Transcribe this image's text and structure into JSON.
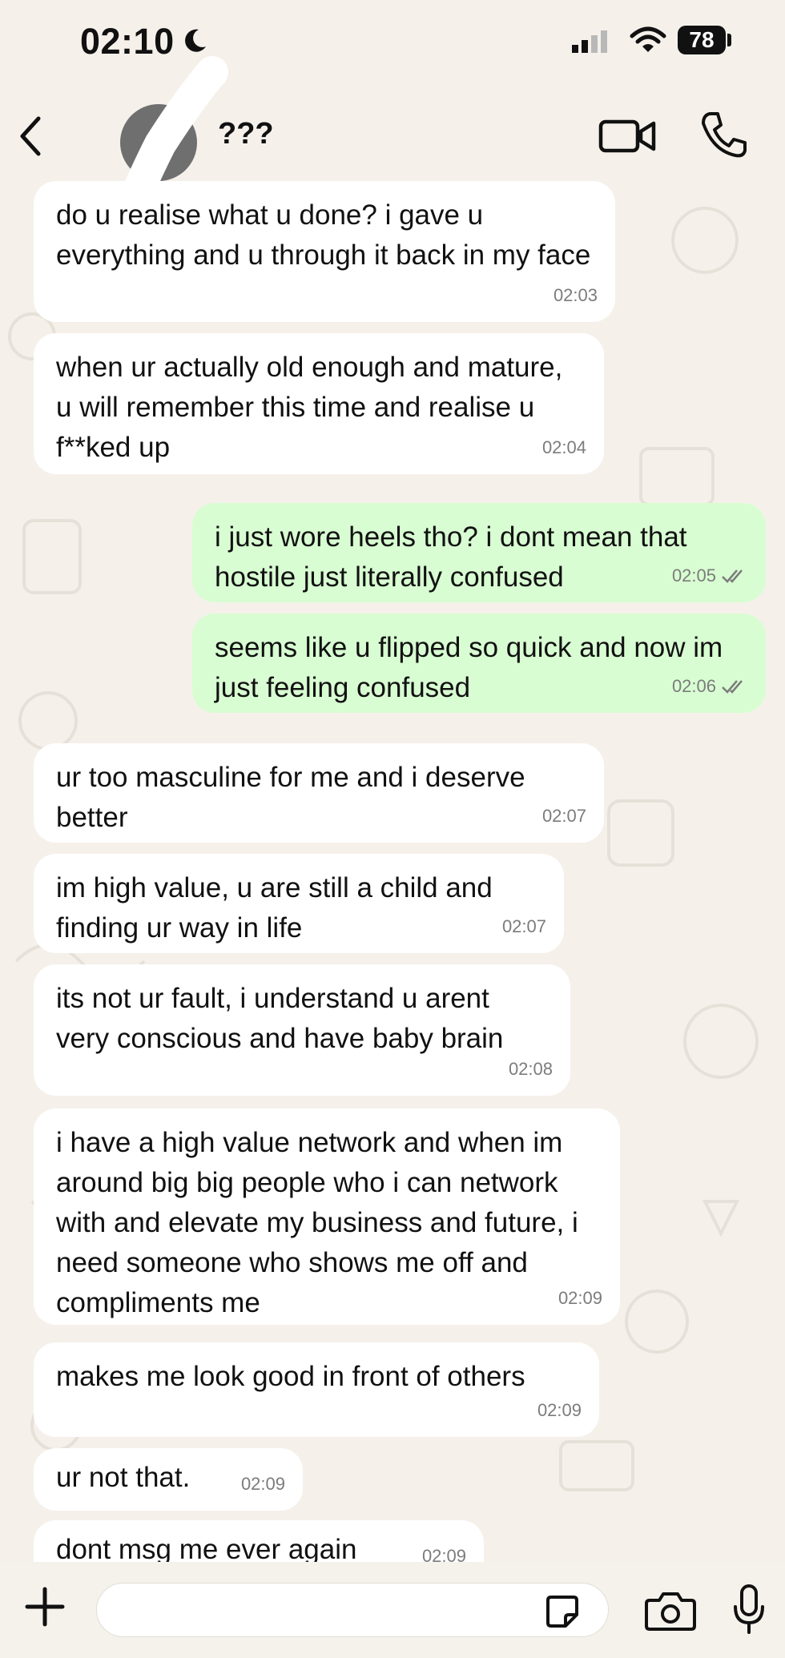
{
  "status_bar": {
    "time": "02:10",
    "battery": "78"
  },
  "header": {
    "contact_name": "???"
  },
  "messages": [
    {
      "dir": "in",
      "text": "do u realise what u done? i gave u everything and u through it back in my face",
      "time": "02:03"
    },
    {
      "dir": "in",
      "text": "when ur actually old enough and mature, u will remember this time and realise u f**ked up",
      "time": "02:04"
    },
    {
      "dir": "out",
      "text": "i just wore heels tho? i dont mean that hostile just literally confused",
      "time": "02:05"
    },
    {
      "dir": "out",
      "text": "seems like u flipped so quick and now im just feeling confused",
      "time": "02:06"
    },
    {
      "dir": "in",
      "text": "ur too masculine for me and i deserve better",
      "time": "02:07"
    },
    {
      "dir": "in",
      "text": "im high value, u are still a child and finding ur way in life",
      "time": "02:07"
    },
    {
      "dir": "in",
      "text": "its not ur fault, i understand u arent very conscious and have baby brain",
      "time": "02:08"
    },
    {
      "dir": "in",
      "text": "i have a high value network and when im around big big people who i can network with and elevate my business and future, i need someone who shows me off and compliments me",
      "time": "02:09"
    },
    {
      "dir": "in",
      "text": "makes me look good in front of others",
      "time": "02:09"
    },
    {
      "dir": "in",
      "text": "ur not that.",
      "time": "02:09"
    },
    {
      "dir": "in",
      "text": "dont msg me ever again",
      "time": "02:09"
    }
  ],
  "colors": {
    "incoming": "#ffffff",
    "outgoing": "#d8fdd2",
    "background": "#f5f1ea"
  },
  "icons": [
    "back-icon",
    "video-call-icon",
    "phone-icon",
    "plus-icon",
    "sticker-icon",
    "camera-icon",
    "mic-icon"
  ]
}
